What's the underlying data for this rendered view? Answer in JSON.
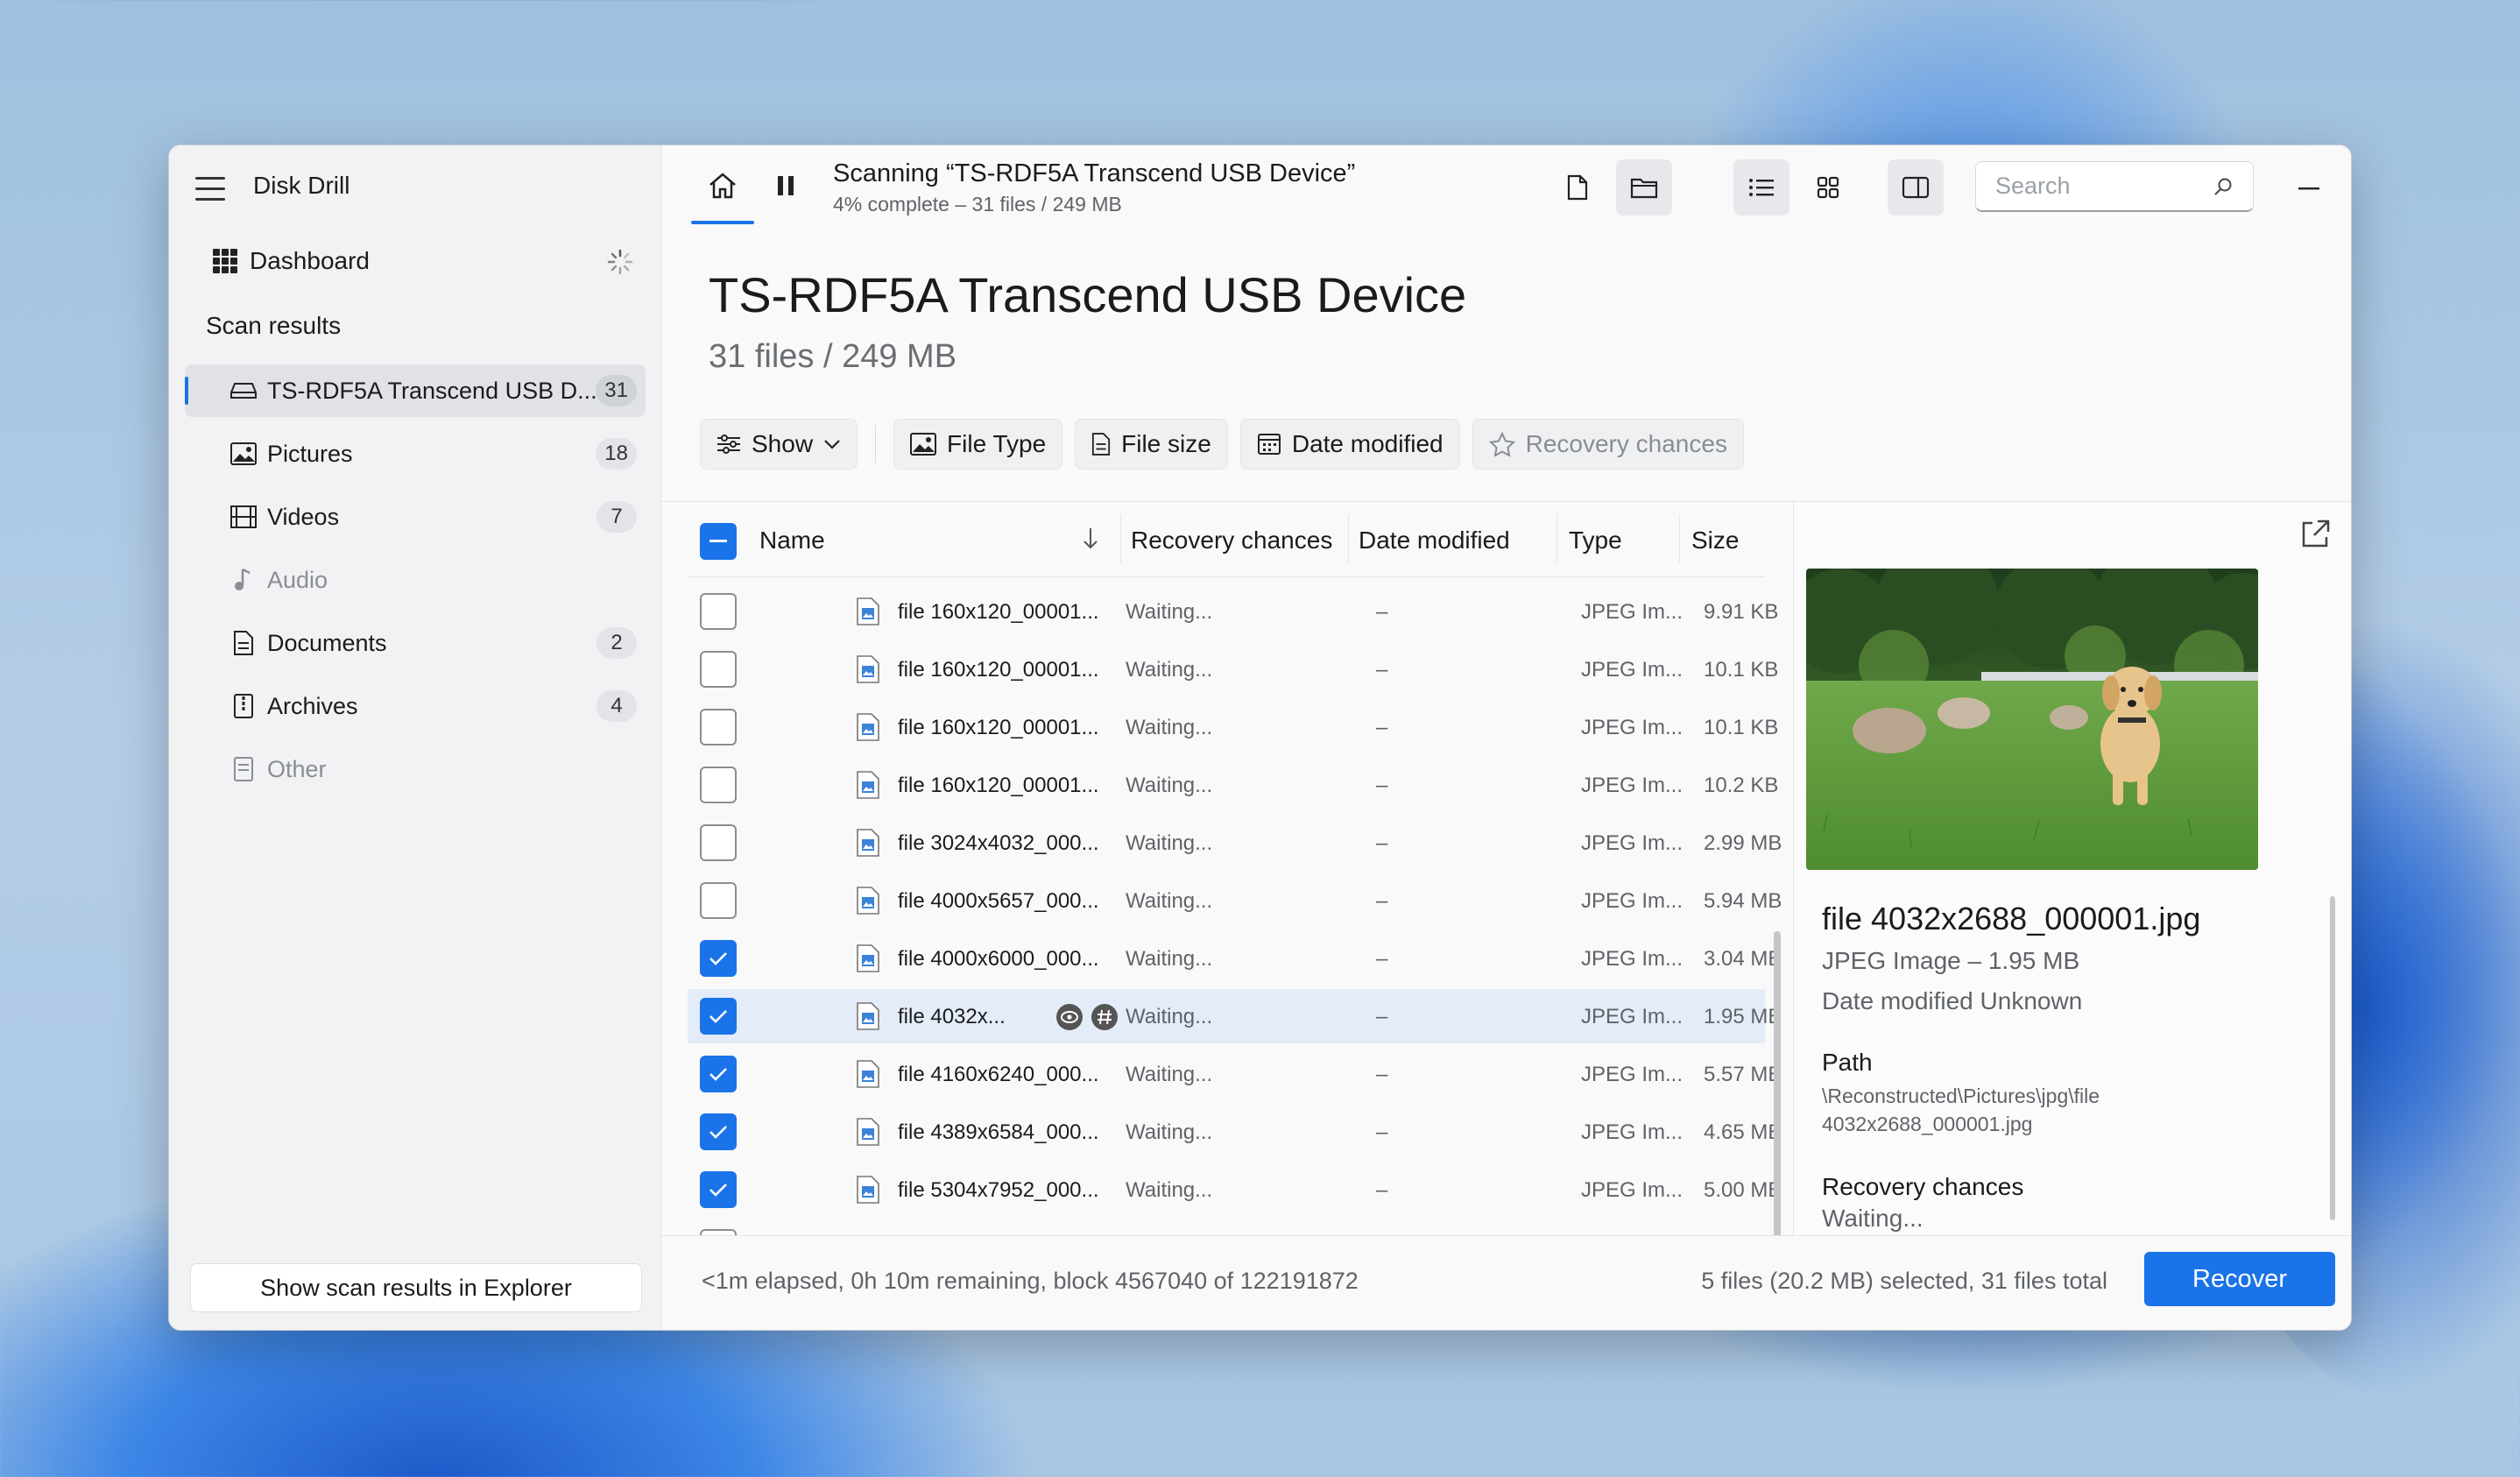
{
  "app": {
    "title": "Disk Drill"
  },
  "sidebar": {
    "dashboard_label": "Dashboard",
    "section_label": "Scan results",
    "items": [
      {
        "label": "TS-RDF5A Transcend USB D...",
        "count": "31",
        "icon": "drive-icon",
        "active": true
      },
      {
        "label": "Pictures",
        "count": "18",
        "icon": "image-icon"
      },
      {
        "label": "Videos",
        "count": "7",
        "icon": "film-icon"
      },
      {
        "label": "Audio",
        "count": "",
        "icon": "music-note-icon",
        "dim": true
      },
      {
        "label": "Documents",
        "count": "2",
        "icon": "document-icon"
      },
      {
        "label": "Archives",
        "count": "4",
        "icon": "archive-icon"
      },
      {
        "label": "Other",
        "count": "",
        "icon": "file-icon",
        "dim": true
      }
    ],
    "explorer_button": "Show scan results in Explorer"
  },
  "toolbar": {
    "scan_title": "Scanning “TS-RDF5A Transcend USB Device”",
    "scan_sub": "4% complete – 31 files / 249 MB",
    "search_placeholder": "Search"
  },
  "device": {
    "title": "TS-RDF5A Transcend USB Device",
    "subtitle": "31 files / 249 MB"
  },
  "filters": {
    "show": "Show",
    "file_type": "File Type",
    "file_size": "File size",
    "date_modified": "Date modified",
    "recovery_chances": "Recovery chances"
  },
  "table": {
    "columns": {
      "name": "Name",
      "recovery": "Recovery chances",
      "date": "Date modified",
      "type": "Type",
      "size": "Size"
    },
    "rows": [
      {
        "name": "file 160x120_00001...",
        "recovery": "Waiting...",
        "date": "–",
        "type": "JPEG Im...",
        "size": "9.91 KB",
        "checked": false
      },
      {
        "name": "file 160x120_00001...",
        "recovery": "Waiting...",
        "date": "–",
        "type": "JPEG Im...",
        "size": "10.1 KB",
        "checked": false
      },
      {
        "name": "file 160x120_00001...",
        "recovery": "Waiting...",
        "date": "–",
        "type": "JPEG Im...",
        "size": "10.1 KB",
        "checked": false
      },
      {
        "name": "file 160x120_00001...",
        "recovery": "Waiting...",
        "date": "–",
        "type": "JPEG Im...",
        "size": "10.2 KB",
        "checked": false
      },
      {
        "name": "file 3024x4032_000...",
        "recovery": "Waiting...",
        "date": "–",
        "type": "JPEG Im...",
        "size": "2.99 MB",
        "checked": false
      },
      {
        "name": "file 4000x5657_000...",
        "recovery": "Waiting...",
        "date": "–",
        "type": "JPEG Im...",
        "size": "5.94 MB",
        "checked": false
      },
      {
        "name": "file 4000x6000_000...",
        "recovery": "Waiting...",
        "date": "–",
        "type": "JPEG Im...",
        "size": "3.04 MB",
        "checked": true
      },
      {
        "name": "file 4032x...",
        "recovery": "Waiting...",
        "date": "–",
        "type": "JPEG Im...",
        "size": "1.95 MB",
        "checked": true,
        "selected": true
      },
      {
        "name": "file 4160x6240_000...",
        "recovery": "Waiting...",
        "date": "–",
        "type": "JPEG Im...",
        "size": "5.57 MB",
        "checked": true
      },
      {
        "name": "file 4389x6584_000...",
        "recovery": "Waiting...",
        "date": "–",
        "type": "JPEG Im...",
        "size": "4.65 MB",
        "checked": true
      },
      {
        "name": "file 5304x7952_000...",
        "recovery": "Waiting...",
        "date": "–",
        "type": "JPEG Im...",
        "size": "5.00 MB",
        "checked": true
      }
    ]
  },
  "preview": {
    "file_name": "file 4032x2688_000001.jpg",
    "meta_type": "JPEG Image – 1.95 MB",
    "meta_date": "Date modified Unknown",
    "path_label": "Path",
    "path_value": "\\Reconstructed\\Pictures\\jpg\\file 4032x2688_000001.jpg",
    "recovery_label": "Recovery chances",
    "recovery_value": "Waiting..."
  },
  "status": {
    "left": "<1m elapsed, 0h 10m remaining, block 4567040 of 122191872",
    "right": "5 files (20.2 MB) selected, 31 files total",
    "recover_button": "Recover"
  },
  "colors": {
    "accent": "#1a73e8"
  }
}
